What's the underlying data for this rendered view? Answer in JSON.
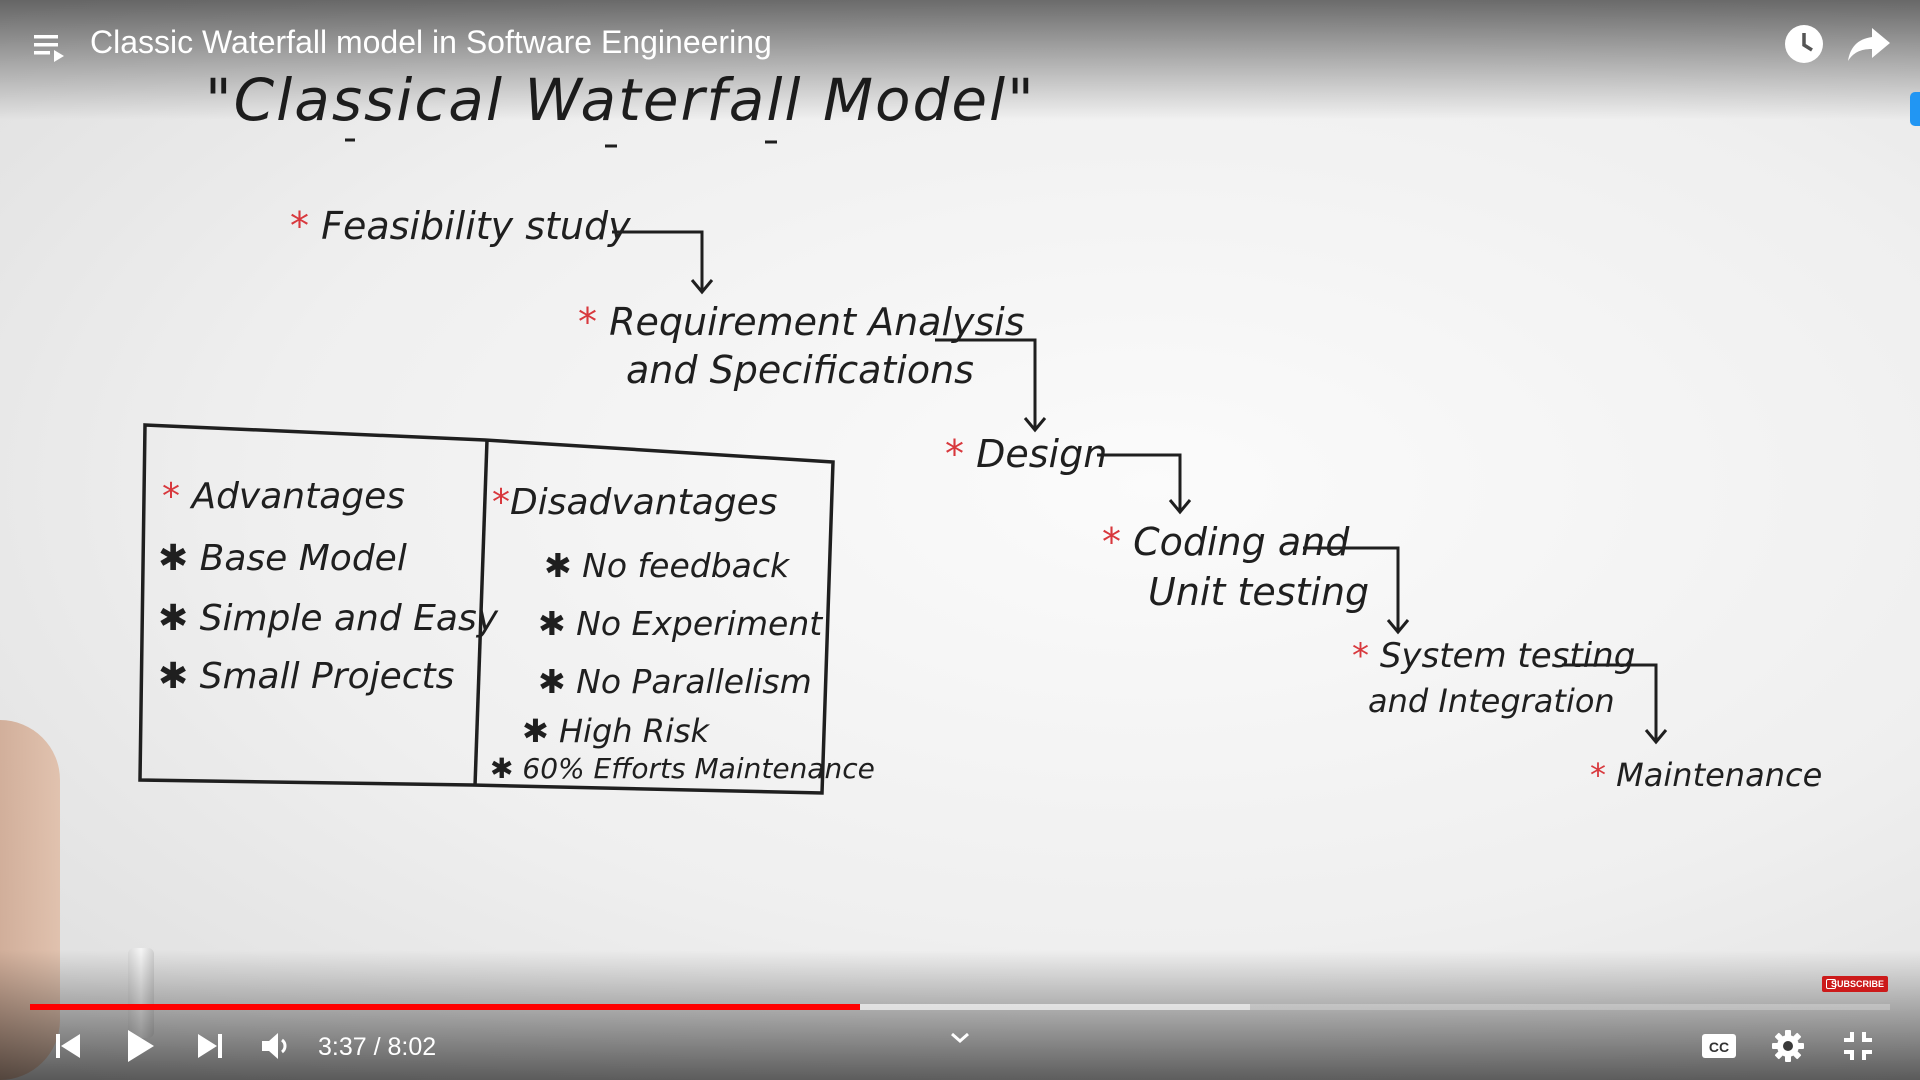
{
  "video": {
    "title": "Classic Waterfall model in Software Engineering",
    "time_current": "3:37",
    "time_total": "8:02",
    "time_display": "3:37 / 8:02",
    "progress_played_fraction": 0.446,
    "progress_buffered_fraction": 0.656
  },
  "whiteboard": {
    "heading": "\"Classical Waterfall Model\"",
    "steps": [
      {
        "star": "*",
        "line1": "Feasibility study",
        "line2": ""
      },
      {
        "star": "*",
        "line1": "Requirement Analysis",
        "line2": "and Specifications"
      },
      {
        "star": "*",
        "line1": "Design",
        "line2": ""
      },
      {
        "star": "*",
        "line1": "Coding and",
        "line2": "Unit testing"
      },
      {
        "star": "*",
        "line1": "System testing",
        "line2": "and Integration"
      },
      {
        "star": "*",
        "line1": "Maintenance",
        "line2": ""
      }
    ],
    "advantages": {
      "heading": "Advantages",
      "items": [
        "Base Model",
        "Simple and Easy",
        "Small Projects"
      ]
    },
    "disadvantages": {
      "heading": "Disadvantages",
      "items": [
        "No feedback",
        "No Experiment",
        "No Parallelism",
        "High Risk",
        "60% Efforts Maintenance"
      ]
    }
  },
  "overlay": {
    "subscribe_label": "SUBSCRIBE"
  },
  "icons": {
    "playlist": "playlist-icon",
    "watch_later": "clock-icon",
    "share": "share-arrow-icon",
    "previous": "skip-previous-icon",
    "play": "play-icon",
    "next": "skip-next-icon",
    "volume": "volume-icon",
    "chevron": "chevron-down-icon",
    "captions": "captions-icon",
    "settings": "gear-icon",
    "exit_fullscreen": "exit-fullscreen-icon"
  },
  "colors": {
    "progress_played": "#ff0000",
    "star_accent": "#d8383d",
    "subscribe_badge": "#cc1a1a"
  }
}
